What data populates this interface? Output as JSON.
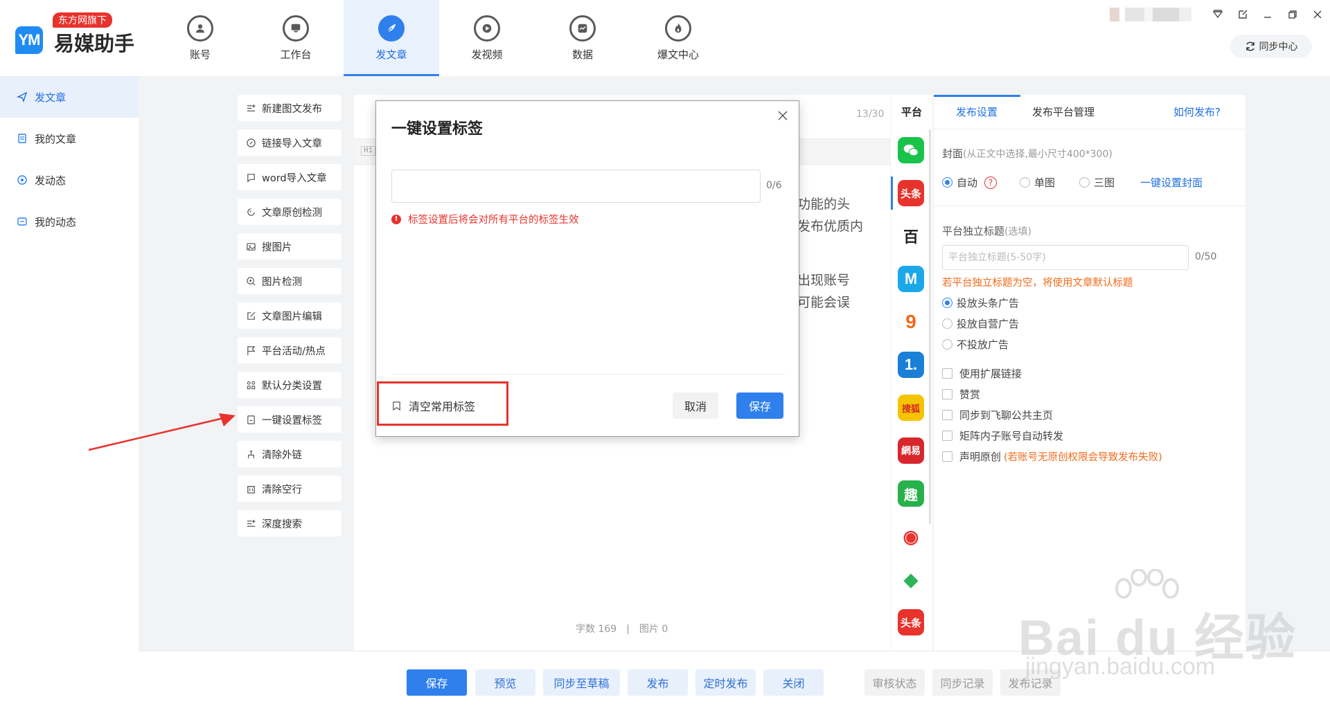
{
  "app": {
    "badge": "东方网旗下",
    "logo_mark": "YM",
    "name": "易媒助手",
    "sync_center": "同步中心"
  },
  "nav": {
    "tabs": [
      {
        "label": "账号",
        "icon": "user-icon"
      },
      {
        "label": "工作台",
        "icon": "monitor-icon"
      },
      {
        "label": "发文章",
        "icon": "feather-icon",
        "active": true
      },
      {
        "label": "发视频",
        "icon": "play-icon"
      },
      {
        "label": "数据",
        "icon": "chart-icon"
      },
      {
        "label": "爆文中心",
        "icon": "flame-icon"
      }
    ]
  },
  "sidebar": {
    "items": [
      {
        "label": "发文章",
        "active": true
      },
      {
        "label": "我的文章"
      },
      {
        "label": "发动态"
      },
      {
        "label": "我的动态"
      }
    ]
  },
  "tools": [
    {
      "label": "新建图文发布",
      "icon": "list-plus-icon"
    },
    {
      "label": "链接导入文章",
      "icon": "link-icon"
    },
    {
      "label": "word导入文章",
      "icon": "word-icon"
    },
    {
      "label": "文章原创检测",
      "icon": "refresh-icon"
    },
    {
      "label": "搜图片",
      "icon": "image-icon"
    },
    {
      "label": "图片检测",
      "icon": "zoom-icon"
    },
    {
      "label": "文章图片编辑",
      "icon": "edit-icon"
    },
    {
      "label": "平台活动/热点",
      "icon": "flag-icon"
    },
    {
      "label": "默认分类设置",
      "icon": "grid-icon"
    },
    {
      "label": "一键设置标签",
      "icon": "tag-icon"
    },
    {
      "label": "清除外链",
      "icon": "clean-icon"
    },
    {
      "label": "清除空行",
      "icon": "trash-icon"
    },
    {
      "label": "深度搜索",
      "icon": "search-list-icon"
    }
  ],
  "editor": {
    "title_counter": "13/30",
    "toolbar_tag": "H1",
    "body_fragments": [
      "功能的头",
      "发布优质内",
      "出现账号",
      "可能会误"
    ],
    "word_count": "字数 169",
    "separator": "|",
    "image_count": "图片 0"
  },
  "platforms": {
    "header": "平台",
    "items": [
      {
        "name": "微信",
        "color": "#19c34a",
        "glyph": "●●"
      },
      {
        "name": "头条",
        "color": "#e8322c",
        "glyph": "头条"
      },
      {
        "name": "百家号",
        "color": "#ffffff",
        "glyph": "百"
      },
      {
        "name": "企鹅号",
        "color": "#1aa8e8",
        "glyph": "M"
      },
      {
        "name": "搜狐",
        "color": "#ffffff",
        "glyph": "9"
      },
      {
        "name": "一点资讯",
        "color": "#1a7fd6",
        "glyph": "1."
      },
      {
        "name": "搜狐号",
        "color": "#f5c400",
        "glyph": "搜狐"
      },
      {
        "name": "网易",
        "color": "#d8262c",
        "glyph": "網易"
      },
      {
        "name": "趣头条",
        "color": "#26b14b",
        "glyph": "趣"
      },
      {
        "name": "微博",
        "color": "#ffffff",
        "glyph": "◉"
      },
      {
        "name": "爱奇艺",
        "color": "#ffffff",
        "glyph": "◆"
      },
      {
        "name": "头条号",
        "color": "#e8322c",
        "glyph": "头条"
      }
    ]
  },
  "settings": {
    "tab_publish": "发布设置",
    "tab_platform": "发布平台管理",
    "help_link": "如何发布?",
    "cover_label": "封面",
    "cover_hint": "(从正文中选择,最小尺寸400*300)",
    "cover_auto": "自动",
    "cover_single": "单图",
    "cover_triple": "三图",
    "cover_oneclick": "一键设置封面",
    "title_label": "平台独立标题",
    "title_hint": "(选填)",
    "title_placeholder": "平台独立标题(5-50字)",
    "title_counter": "0/50",
    "title_warning": "若平台独立标题为空，将使用文章默认标题",
    "ad_toutiao": "投放头条广告",
    "ad_self": "投放自营广告",
    "ad_none": "不投放广告",
    "ext_link": "使用扩展链接",
    "reward": "赞赏",
    "sync_feiliao": "同步到飞聊公共主页",
    "matrix_forward": "矩阵内子账号自动转发",
    "declare_original": "声明原创",
    "original_warning": "(若账号无原创权限会导致发布失败)"
  },
  "bottom": {
    "save": "保存",
    "preview": "预览",
    "sync_draft": "同步至草稿",
    "publish": "发布",
    "schedule": "定时发布",
    "close": "关闭",
    "review": "审核状态",
    "sync_log": "同步记录",
    "publish_log": "发布记录"
  },
  "modal": {
    "title": "一键设置标签",
    "input_counter": "0/6",
    "input_value": "",
    "warning": "标签设置后将会对所有平台的标签生效",
    "clear_tags": "清空常用标签",
    "cancel": "取消",
    "save": "保存"
  },
  "watermark": {
    "brand": "Bai du 经验",
    "url": "jingyan.baidu.com"
  },
  "colors": {
    "accent": "#2f80ed",
    "danger": "#e8322c",
    "warning": "#f26a1b"
  }
}
